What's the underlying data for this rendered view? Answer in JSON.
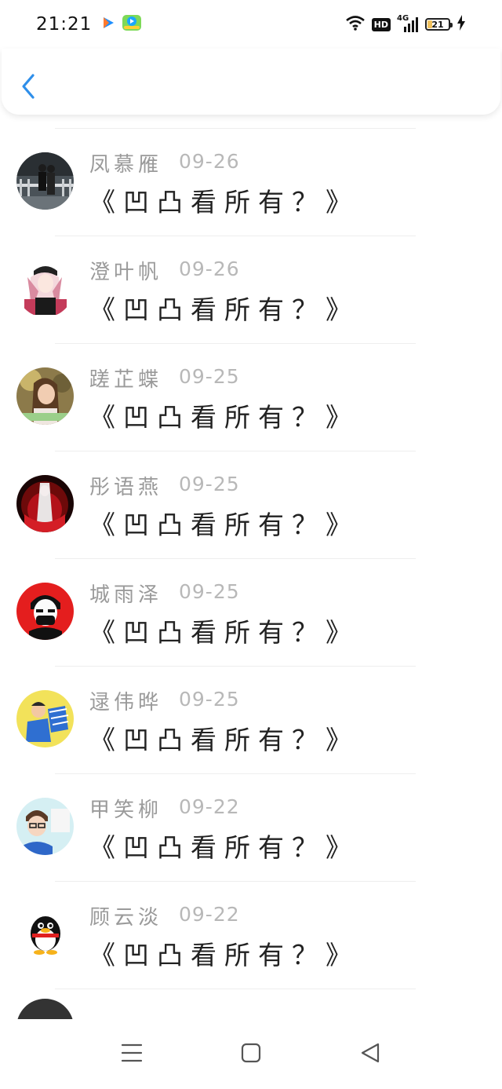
{
  "status_bar": {
    "time": "21:21",
    "network_badge": "HD",
    "network_type": "4G",
    "battery_level": "21"
  },
  "messages": [
    {
      "name": "凤慕雁",
      "date": "09-26",
      "title": "《凹凸看所有？》",
      "avatar_icon": "couple-photo-avatar"
    },
    {
      "name": "澄叶帆",
      "date": "09-26",
      "title": "《凹凸看所有？》",
      "avatar_icon": "anime-girl-avatar"
    },
    {
      "name": "蹉芷蝶",
      "date": "09-25",
      "title": "《凹凸看所有？》",
      "avatar_icon": "girl-photo-avatar"
    },
    {
      "name": "彤语燕",
      "date": "09-25",
      "title": "《凹凸看所有？》",
      "avatar_icon": "dark-red-figure-avatar"
    },
    {
      "name": "城雨泽",
      "date": "09-25",
      "title": "《凹凸看所有？》",
      "avatar_icon": "masked-boy-avatar"
    },
    {
      "name": "逯伟晔",
      "date": "09-25",
      "title": "《凹凸看所有？》",
      "avatar_icon": "yellow-cartoon-avatar"
    },
    {
      "name": "甲笑柳",
      "date": "09-22",
      "title": "《凹凸看所有？》",
      "avatar_icon": "boy-glasses-avatar"
    },
    {
      "name": "顾云淡",
      "date": "09-22",
      "title": "《凹凸看所有？》",
      "avatar_icon": "qq-penguin-avatar"
    },
    {
      "name": "",
      "date": "",
      "title": "",
      "avatar_icon": "partial-avatar"
    }
  ],
  "colors": {
    "accent": "#2f8fea",
    "name_gray": "#9a9a9a",
    "date_gray": "#b8b8b8",
    "title_dark": "#222222"
  }
}
